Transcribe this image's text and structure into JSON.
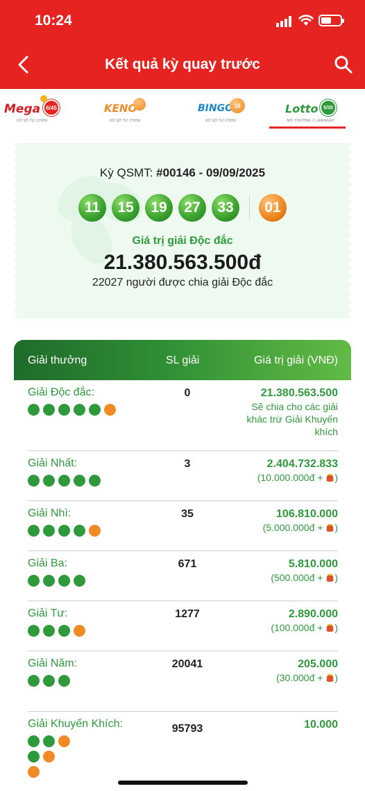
{
  "status_bar": {
    "time": "10:24"
  },
  "nav": {
    "title": "Kết quả kỳ quay trước"
  },
  "tabs": [
    {
      "name": "Mega",
      "badge": "6/45",
      "sub": "XỔ SỐ TỰ CHỌN"
    },
    {
      "name": "KENO",
      "sub": "XỔ SỐ TỰ CHỌN"
    },
    {
      "name": "BINGO",
      "badge": "18",
      "sub": "XỔ SỐ TỰ CHỌN"
    },
    {
      "name": "Lotto",
      "badge": "5/35",
      "sub": "MỞ THƯỞNG 2 LẦN/NGÀY",
      "active": true
    }
  ],
  "result": {
    "draw_prefix": "Kỳ QSMT: ",
    "draw_code": "#00146 - 09/09/2025",
    "numbers": [
      "11",
      "15",
      "19",
      "27",
      "33"
    ],
    "special_number": "01",
    "jackpot_label": "Giá trị giải Độc đắc",
    "jackpot_value": "21.380.563.500đ",
    "jackpot_winners": "22027 người được chia giải Độc đắc"
  },
  "table": {
    "headers": {
      "prize": "Giải thưởng",
      "count": "SL giải",
      "value": "Giá trị giải (VNĐ)"
    },
    "rows": [
      {
        "name": "Giải Độc đắc:",
        "count": "0",
        "value": "21.380.563.500",
        "note": "Sẽ chia cho các giải khác trừ Giải Khuyến khích",
        "dots": [
          [
            "g",
            "g",
            "g",
            "g",
            "g",
            "o"
          ]
        ]
      },
      {
        "name": "Giải Nhất:",
        "count": "3",
        "value": "2.404.732.833",
        "note_pre": "(10.000.000đ + ",
        "note_post": ")",
        "dots": [
          [
            "g",
            "g",
            "g",
            "g",
            "g"
          ]
        ]
      },
      {
        "name": "Giải Nhì:",
        "count": "35",
        "value": "106.810.000",
        "note_pre": "(5.000.000đ + ",
        "note_post": ")",
        "dots": [
          [
            "g",
            "g",
            "g",
            "g",
            "o"
          ]
        ]
      },
      {
        "name": "Giải Ba:",
        "count": "671",
        "value": "5.810.000",
        "note_pre": "(500.000đ + ",
        "note_post": ")",
        "dots": [
          [
            "g",
            "g",
            "g",
            "g"
          ]
        ]
      },
      {
        "name": "Giải Tư:",
        "count": "1277",
        "value": "2.890.000",
        "note_pre": "(100.000đ + ",
        "note_post": ")",
        "dots": [
          [
            "g",
            "g",
            "g",
            "o"
          ]
        ]
      },
      {
        "name": "Giải Năm:",
        "count": "20041",
        "value": "205.000",
        "note_pre": "(30.000đ + ",
        "note_post": ")",
        "dots": [
          [
            "g",
            "g",
            "g"
          ]
        ]
      },
      {
        "name": "Giải Khuyến Khích:",
        "count": "95793",
        "value": "10.000",
        "dots": [
          [
            "g",
            "g",
            "o"
          ],
          [
            "g",
            "o"
          ],
          [
            "o"
          ]
        ]
      }
    ]
  },
  "colors": {
    "brand_red": "#e52421",
    "green": "#2e9a3b",
    "orange": "#f08a24"
  }
}
